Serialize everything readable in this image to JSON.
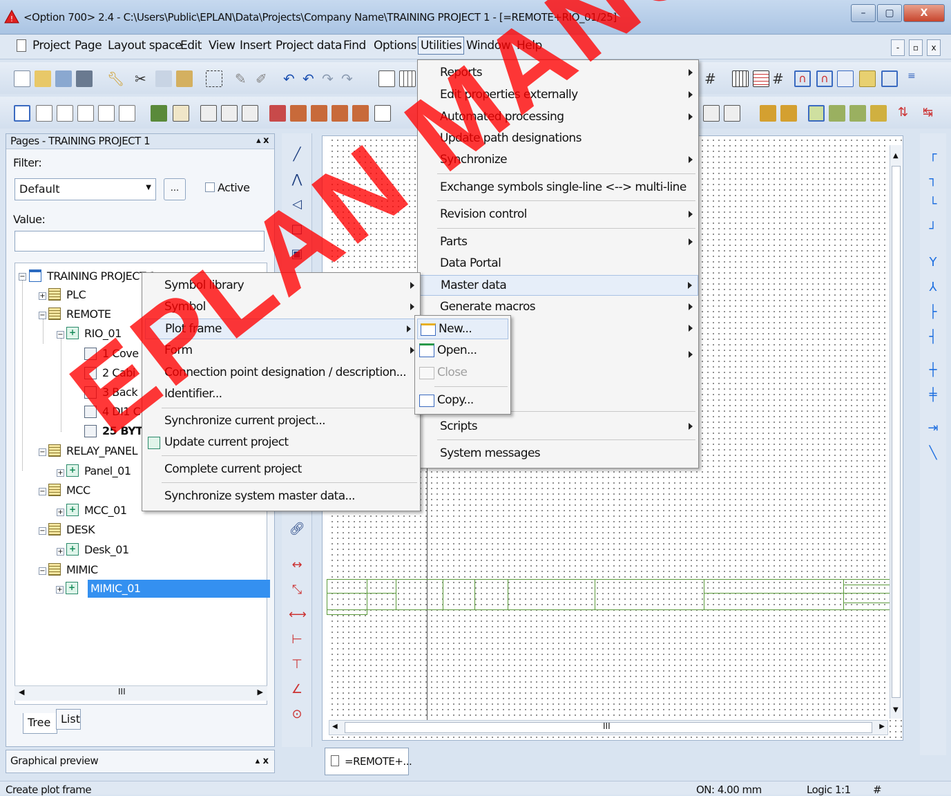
{
  "window": {
    "title": "<Option 700> 2.4 - C:\\Users\\Public\\EPLAN\\Data\\Projects\\Company Name\\TRAINING PROJECT 1 - [=REMOTE+RIO_01/25]",
    "min": "–",
    "max": "▢",
    "close": "X"
  },
  "menubar": {
    "items": [
      "Project",
      "Page",
      "Layout space",
      "Edit",
      "View",
      "Insert",
      "Project data",
      "Find",
      "Options",
      "Utilities",
      "Window",
      "Help"
    ],
    "active": "Utilities"
  },
  "mdi": {
    "min": "-",
    "restore": "▫",
    "close": "x"
  },
  "pages_panel": {
    "title": "Pages - TRAINING PROJECT 1",
    "pin": "▴ x",
    "filter_label": "Filter:",
    "filter_value": "Default",
    "dots": "...",
    "active_label": "Active",
    "value_label": "Value:",
    "tree": [
      {
        "label": "TRAINING PROJECT 1"
      },
      {
        "label": "PLC"
      },
      {
        "label": "REMOTE"
      },
      {
        "label": "RIO_01"
      },
      {
        "label": "1 Cove"
      },
      {
        "label": "2 Cabi"
      },
      {
        "label": "3 Back"
      },
      {
        "label": "4 DI1 C"
      },
      {
        "label": "25 BYT"
      },
      {
        "label": "RELAY_PANEL"
      },
      {
        "label": "Panel_01"
      },
      {
        "label": "MCC"
      },
      {
        "label": "MCC_01"
      },
      {
        "label": "DESK"
      },
      {
        "label": "Desk_01"
      },
      {
        "label": "MIMIC"
      },
      {
        "label": "MIMIC_01"
      }
    ],
    "scroll_mid": "III",
    "tabs": [
      "Tree",
      "List"
    ]
  },
  "graphical_preview": {
    "title": "Graphical preview",
    "pin": "▴ x"
  },
  "doc_tab": "=REMOTE+...",
  "canvas_scroll": "III",
  "status": {
    "left": "Create plot frame",
    "grid": "ON: 4.00 mm",
    "logic": "Logic 1:1",
    "hash": "#"
  },
  "utilities_menu": [
    {
      "label": "Reports",
      "sub": true
    },
    {
      "label": "Edit properties externally",
      "sub": true
    },
    {
      "label": "Automated processing",
      "sub": true
    },
    {
      "label": "Update path designations",
      "sub": false
    },
    {
      "label": "Synchronize",
      "sub": true
    },
    {
      "label": "Exchange symbols single-line <--> multi-line",
      "sub": false
    },
    {
      "label": "Revision control",
      "sub": true
    },
    {
      "label": "Parts",
      "sub": true
    },
    {
      "label": "Data Portal",
      "sub": false
    },
    {
      "label": "Master data",
      "sub": true
    },
    {
      "label": "Generate macros",
      "sub": true
    },
    {
      "label": "",
      "sub": true
    },
    {
      "label": "",
      "sub": true
    },
    {
      "label": "Scripts",
      "sub": true
    },
    {
      "label": "System messages",
      "sub": false
    }
  ],
  "master_data_menu": [
    {
      "label": "Symbol library",
      "sub": true
    },
    {
      "label": "Symbol",
      "sub": true
    },
    {
      "label": "Plot frame",
      "sub": true
    },
    {
      "label": "Form",
      "sub": true
    },
    {
      "label": "Connection point designation / description...",
      "sub": false
    },
    {
      "label": "Identifier...",
      "sub": false
    },
    {
      "label": "Synchronize current project...",
      "sub": false
    },
    {
      "label": "Update current project",
      "sub": false
    },
    {
      "label": "Complete current project",
      "sub": false
    },
    {
      "label": "Synchronize system master data...",
      "sub": false
    }
  ],
  "plot_frame_menu": [
    {
      "label": "New..."
    },
    {
      "label": "Open..."
    },
    {
      "label": "Close"
    },
    {
      "label": "Copy..."
    }
  ],
  "watermark": "EPLAN MANUAL",
  "colors": {
    "selection": "#3490f0",
    "grid_frame": "#5a9a3a",
    "watermark": "#ff0000"
  }
}
